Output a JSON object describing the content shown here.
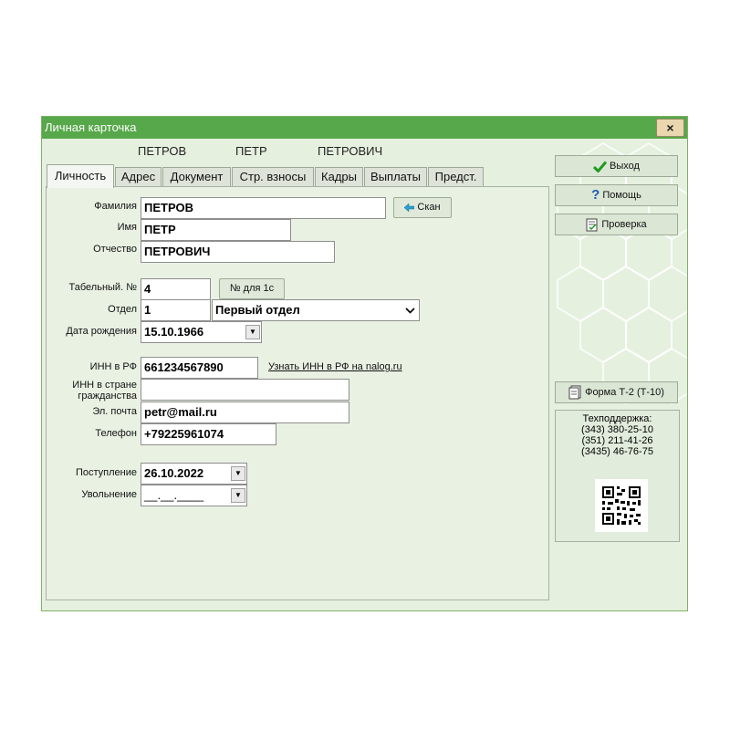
{
  "window": {
    "title": "Личная карточка",
    "close_label": "×"
  },
  "header_name": {
    "last": "ПЕТРОВ",
    "first": "ПЕТР",
    "middle": "ПЕТРОВИЧ"
  },
  "tabs": [
    {
      "label": "Личность",
      "active": true
    },
    {
      "label": "Адрес"
    },
    {
      "label": "Документ"
    },
    {
      "label": "Стр. взносы"
    },
    {
      "label": "Кадры"
    },
    {
      "label": "Выплаты"
    },
    {
      "label": "Предст."
    }
  ],
  "form": {
    "surname_label": "Фамилия",
    "surname_value": "ПЕТРОВ",
    "scan_label": "Скан",
    "name_label": "Имя",
    "name_value": "ПЕТР",
    "patronymic_label": "Отчество",
    "patronymic_value": "ПЕТРОВИЧ",
    "tabnum_label": "Табельный. №",
    "tabnum_value": "4",
    "num1c_label": "№ для 1с",
    "dept_label": "Отдел",
    "dept_code": "1",
    "dept_name": "Первый отдел",
    "birth_label": "Дата рождения",
    "birth_value": "15.10.1966",
    "inn_label": "ИНН в РФ",
    "inn_value": "661234567890",
    "inn_link": "Узнать ИНН в РФ на nalog.ru",
    "inn_foreign_label_1": "ИНН в стране",
    "inn_foreign_label_2": "гражданства",
    "inn_foreign_value": "",
    "email_label": "Эл. почта",
    "email_value": "petr@mail.ru",
    "phone_label": "Телефон",
    "phone_value": "+79225961074",
    "hire_label": "Поступление",
    "hire_value": "26.10.2022",
    "fire_label": "Увольнение",
    "fire_value": "__.__.____"
  },
  "right_panel": {
    "exit_label": "Выход",
    "help_label": "Помощь",
    "check_label": "Проверка",
    "form_t2_label": "Форма Т-2  (Т-10)",
    "support_title": "Техподдержка:",
    "phones": [
      "(343) 380-25-10",
      "(351) 211-41-26",
      "(3435) 46-76-75"
    ]
  },
  "icons": {
    "scan": "arrow-left-icon",
    "exit": "checkmark-icon",
    "help": "question-icon",
    "check": "document-check-icon",
    "form": "document-icon",
    "qr": "qr-code-icon"
  },
  "colors": {
    "title_bar": "#57a84a",
    "window_bg": "#e6f0df",
    "exit_check": "#1e9a1e",
    "help_q": "#1a5fb4"
  }
}
